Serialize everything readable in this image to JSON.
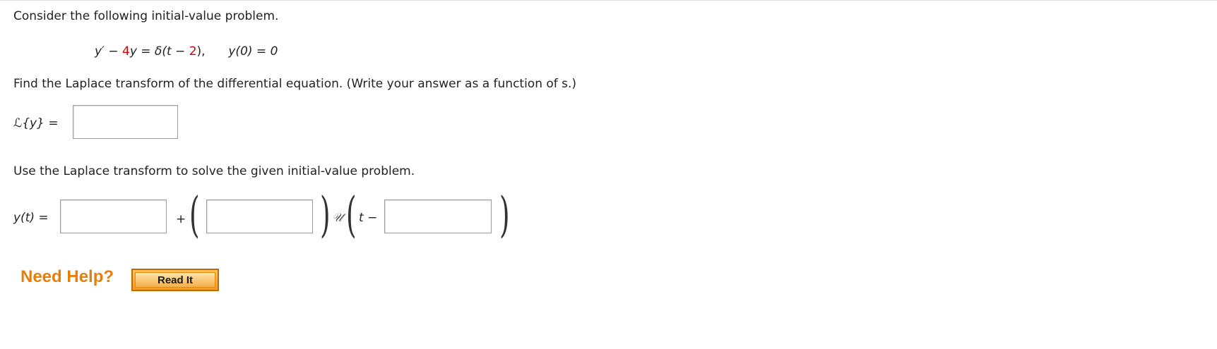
{
  "intro": "Consider the following initial-value problem.",
  "equation": {
    "lhs_prefix": "y′ − ",
    "coef": "4",
    "lhs_suffix": "y = δ(t − ",
    "shift": "2",
    "rhs_close": "),",
    "ic": "y(0) = 0"
  },
  "part1": {
    "instruction": "Find the Laplace transform of the differential equation. (Write your answer as a function of s.)",
    "label": "ℒ{y}  =",
    "answer_value": ""
  },
  "part2": {
    "instruction": "Use the Laplace transform to solve the given initial-value problem.",
    "label": "y(t) =",
    "plus": "+",
    "unit_step": "𝒰",
    "t_minus": "t −",
    "answers": [
      "",
      "",
      ""
    ]
  },
  "help": {
    "label": "Need Help?",
    "button": "Read It"
  }
}
